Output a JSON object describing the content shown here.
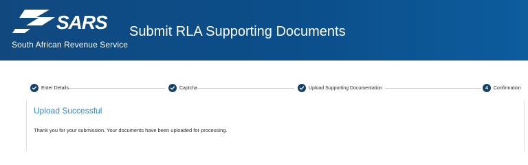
{
  "header": {
    "logo_text": "SARS",
    "subtitle": "South African Revenue Service",
    "title": "Submit RLA Supporting Documents"
  },
  "stepper": {
    "steps": [
      {
        "label": "Enter Details",
        "state": "completed",
        "icon": "check-icon"
      },
      {
        "label": "Captcha",
        "state": "completed",
        "icon": "check-icon"
      },
      {
        "label": "Upload Supporting Documentation",
        "state": "completed",
        "icon": "check-icon"
      },
      {
        "label": "Confirmation",
        "state": "current",
        "number": "4"
      }
    ]
  },
  "content": {
    "status_title": "Upload Successful",
    "message": "Thank you for your submission. Your documents have been uploaded for processing."
  },
  "colors": {
    "header_bg": "#0b4e8a",
    "accent_blue": "#2f88c8",
    "step_circle": "#14406d",
    "text": "#2b2b2b"
  }
}
